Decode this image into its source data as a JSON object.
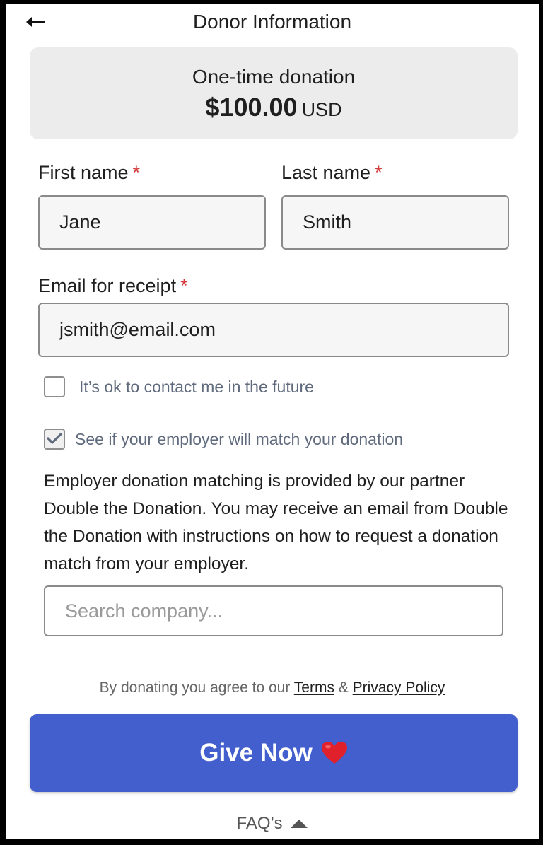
{
  "header": {
    "title": "Donor Information",
    "back_icon": "arrow-left-icon"
  },
  "summary": {
    "frequency": "One-time donation",
    "amount": "$100.00",
    "currency": "USD"
  },
  "form": {
    "first_name_label": "First name",
    "last_name_label": "Last name",
    "email_label": "Email for receipt",
    "required_mark": "*",
    "first_name_value": "Jane",
    "last_name_value": "Smith",
    "email_value": "jsmith@email.com",
    "contact_label": "It’s ok to contact me in the future",
    "contact_checked": false,
    "match_label": "See if your employer will match your donation",
    "match_checked": true,
    "match_info": "Employer donation matching is provided by our partner Double the Donation. You may receive an email from Double the Donation with instructions on how to request a donation match from your employer.",
    "company_placeholder": "Search company..."
  },
  "legal": {
    "prefix": "By donating you agree to our",
    "terms": "Terms",
    "amp": "&",
    "privacy": "Privacy Policy"
  },
  "cta": {
    "label": "Give Now",
    "icon": "heart-icon"
  },
  "faq": {
    "label": "FAQ’s",
    "icon": "triangle-up-icon"
  },
  "colors": {
    "primary_button": "#435fce",
    "required": "#d33a3a",
    "summary_bg": "#ececec"
  }
}
